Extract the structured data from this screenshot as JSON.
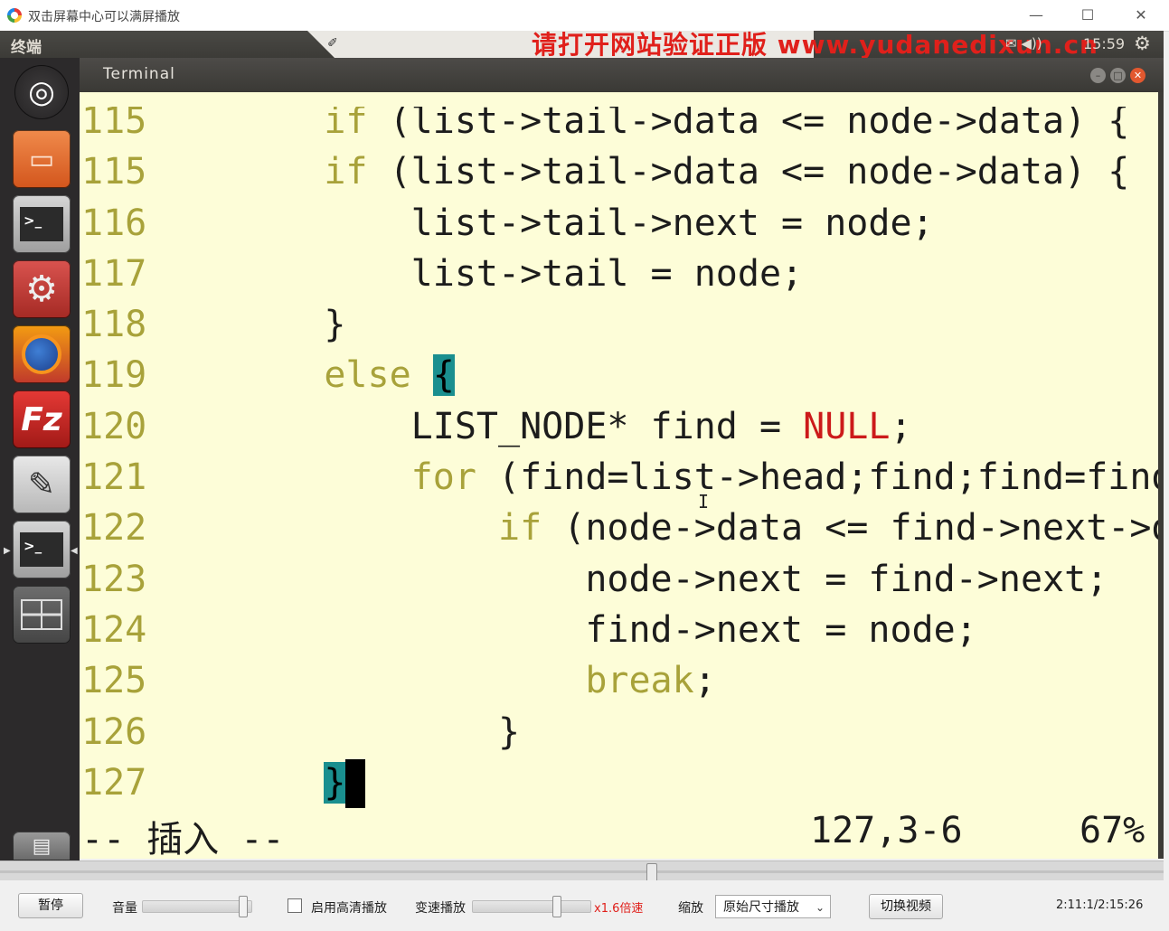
{
  "window": {
    "title": "双击屏幕中心可以满屏播放",
    "minimize": "—",
    "maximize": "☐",
    "close": "✕"
  },
  "top_panel": {
    "title": "终端",
    "watermark": "请打开网站验证正版 www.yudanedixun.cn",
    "clock": "15:59",
    "indicators": "✉ ◀))"
  },
  "launcher": {
    "items": [
      {
        "name": "ubuntu-dash-icon",
        "glyph": "◎"
      },
      {
        "name": "files-icon",
        "glyph": "▭"
      },
      {
        "name": "terminal-icon",
        "glyph": ">_"
      },
      {
        "name": "system-settings-icon",
        "glyph": "⚙"
      },
      {
        "name": "firefox-icon",
        "glyph": "◉"
      },
      {
        "name": "filezilla-icon",
        "glyph": "Fz"
      },
      {
        "name": "text-editor-icon",
        "glyph": "✎"
      },
      {
        "name": "terminal-active-icon",
        "glyph": ">_"
      },
      {
        "name": "workspace-switcher-icon",
        "glyph": "▦"
      },
      {
        "name": "trash-icon",
        "glyph": "🗑"
      }
    ]
  },
  "terminal": {
    "title": "Terminal",
    "lines": [
      {
        "num": "115",
        "indent": "    ",
        "kw": "if",
        "text": " (list->tail->data <= node->data) {",
        "partial": true
      },
      {
        "num": "115",
        "indent": "    ",
        "kw": "if",
        "text": " (list->tail->data <= node->data) {"
      },
      {
        "num": "116",
        "indent": "        ",
        "kw": "",
        "text": "list->tail->next = node;"
      },
      {
        "num": "117",
        "indent": "        ",
        "kw": "",
        "text": "list->tail = node;"
      },
      {
        "num": "118",
        "indent": "    ",
        "kw": "",
        "text": "}"
      },
      {
        "num": "119",
        "indent": "    ",
        "kw": "else",
        "text": " ",
        "bracket": "{"
      },
      {
        "num": "120",
        "indent": "        ",
        "kw": "",
        "text": "LIST_NODE* find = ",
        "null": "NULL",
        "tail": ";"
      },
      {
        "num": "121",
        "indent": "        ",
        "kw": "for",
        "text": " (find=list->head;find;find=find->next)"
      },
      {
        "num": "122",
        "indent": "            ",
        "kw": "if",
        "text": " (node->data <= find->next->data) {"
      },
      {
        "num": "123",
        "indent": "                ",
        "kw": "",
        "text": "node->next = find->next;"
      },
      {
        "num": "124",
        "indent": "                ",
        "kw": "",
        "text": "find->next = node;"
      },
      {
        "num": "125",
        "indent": "                ",
        "kw": "break",
        "text": ";"
      },
      {
        "num": "126",
        "indent": "            ",
        "kw": "",
        "text": "}"
      },
      {
        "num": "127",
        "indent": "    ",
        "kw": "",
        "text": "",
        "bracket": "}",
        "cursor": true
      }
    ],
    "status": {
      "mode": "-- 插入 --",
      "position": "127,3-6",
      "percent": "67%"
    }
  },
  "player": {
    "pause": "暂停",
    "volume_label": "音量",
    "volume_level": 0.95,
    "hd_label": "启用高清播放",
    "speed_label": "变速播放",
    "speed_level": 0.6,
    "speed_value": "x1.6倍速",
    "zoom_label": "缩放",
    "zoom_option": "原始尺寸播放",
    "switch_video": "切换视频",
    "time": "2:11:1/2:15:26",
    "progress": 0.56
  }
}
